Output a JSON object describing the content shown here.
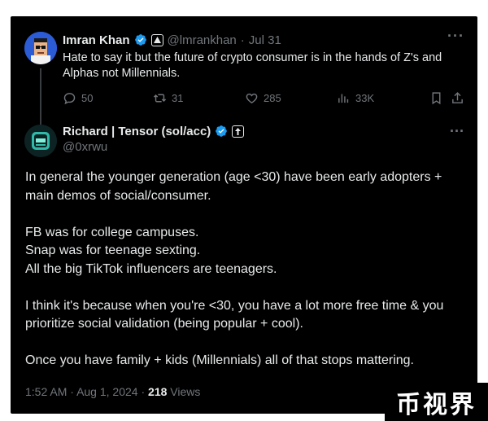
{
  "tweet1": {
    "author_name": "Imran Khan",
    "handle": "@lmrankhan",
    "separator": "·",
    "date": "Jul 31",
    "text": "Hate to say it but the future of crypto consumer is in the hands of Z's and Alphas not Millennials.",
    "replies": "50",
    "reposts": "31",
    "likes": "285",
    "views": "33K",
    "accent_color": "#1d9bf0"
  },
  "tweet2": {
    "author_name": "Richard | Tensor (sol/acc)",
    "handle": "@0xrwu",
    "paragraphs": [
      "In general the younger generation (age <30) have been early adopters + main demos of social/consumer.",
      "FB was for college campuses.",
      "Snap was for teenage sexting.",
      "All the big TikTok influencers are teenagers.",
      "I think it's because when you're <30, you have a lot more free time & you prioritize social validation (being popular + cool).",
      "Once you have family + kids (Millennials) all of that stops mattering."
    ],
    "time": "1:52 AM",
    "separator": "·",
    "date": "Aug 1, 2024",
    "views_count": "218",
    "views_label": "Views"
  },
  "watermark": "币视界"
}
